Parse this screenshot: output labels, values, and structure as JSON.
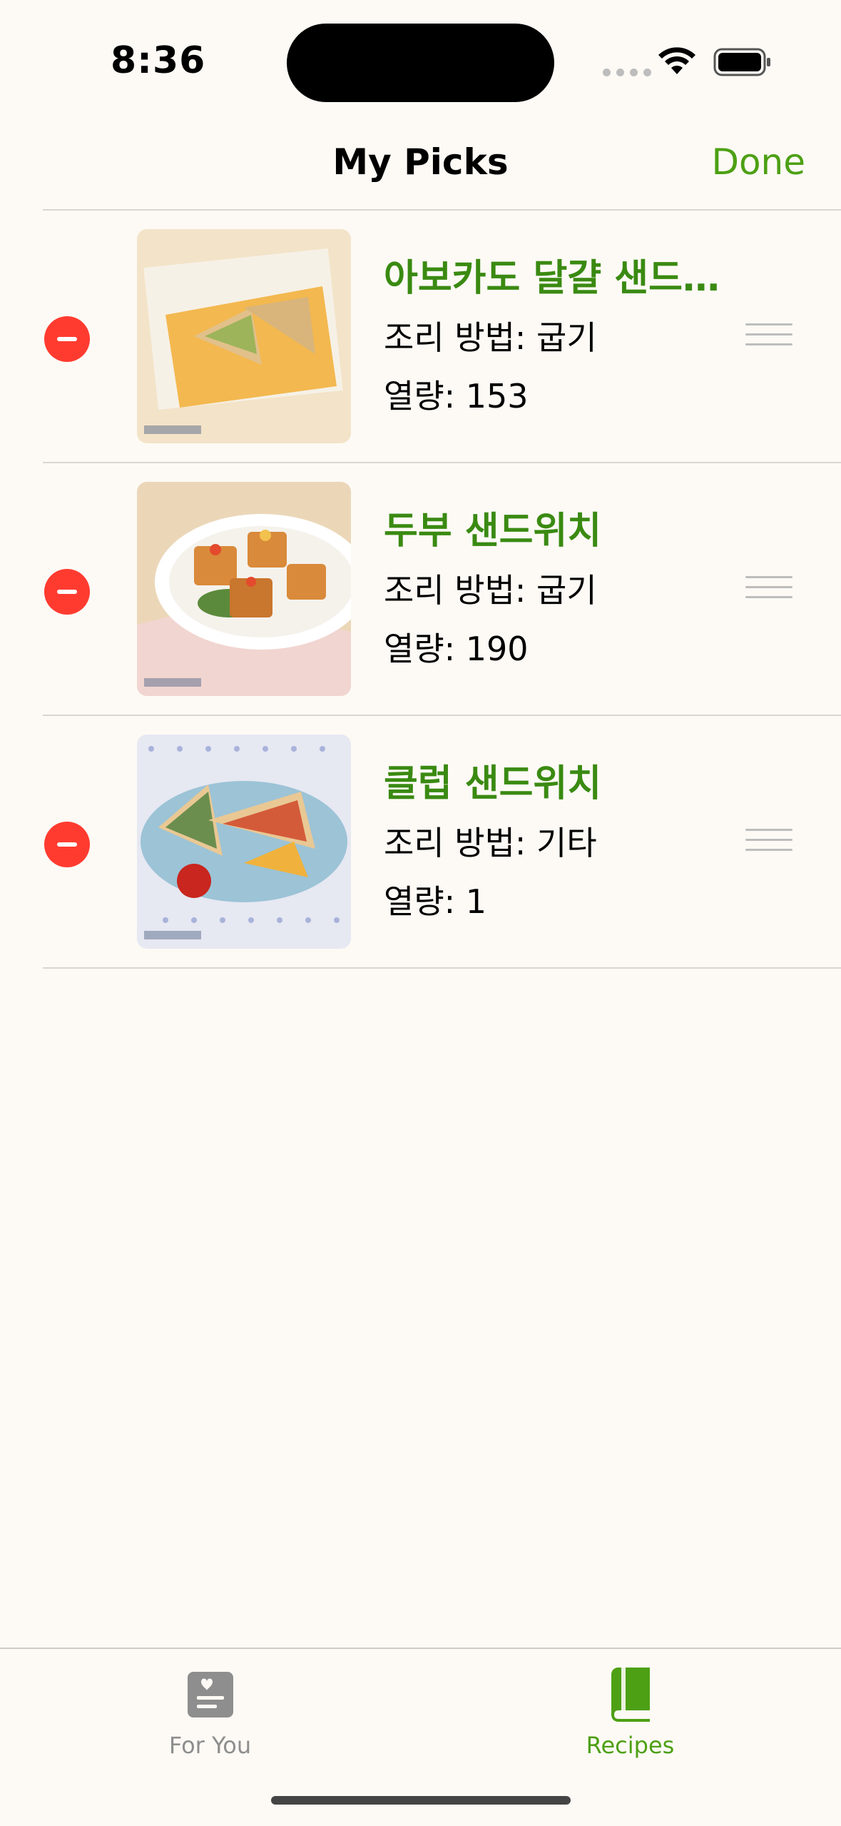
{
  "status_bar": {
    "time": "8:36"
  },
  "nav": {
    "title": "My Picks",
    "done_label": "Done"
  },
  "recipes": [
    {
      "title": "아보카도 달걀 샌드…",
      "method": "조리 방법: 굽기",
      "calories": "열량: 153"
    },
    {
      "title": "두부 샌드위치",
      "method": "조리 방법: 굽기",
      "calories": "열량: 190"
    },
    {
      "title": "클럽 샌드위치",
      "method": "조리 방법: 기타",
      "calories": "열량: 1"
    }
  ],
  "tab_bar": {
    "tabs": [
      {
        "label": "For You",
        "icon": "heart-list-icon",
        "selected": false
      },
      {
        "label": "Recipes",
        "icon": "book-icon",
        "selected": true
      }
    ]
  },
  "colors": {
    "accent": "#4DA014",
    "title_green": "#3A8A12",
    "delete_red": "#FF3B30",
    "background": "#FDFAF5"
  }
}
